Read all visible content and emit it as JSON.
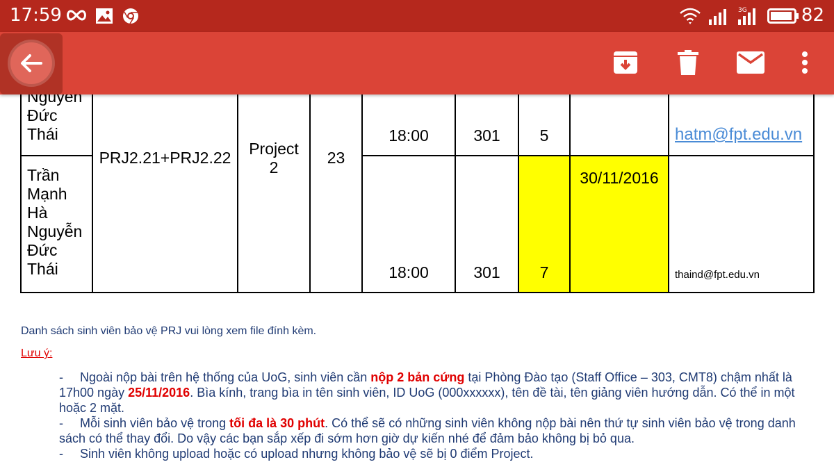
{
  "status_bar": {
    "time": "17:59",
    "battery": "82",
    "network": "3G"
  },
  "toolbar": {
    "icons": [
      "back-arrow-icon",
      "archive-icon",
      "delete-icon",
      "mail-icon",
      "more-vert-icon"
    ],
    "accent_color": "#db4437"
  },
  "schedule": {
    "row1": {
      "names": [
        "Nguyễn",
        "Đức",
        "Thái"
      ],
      "time": "18:00",
      "room": "301",
      "order": "5",
      "email": "hatm@fpt.edu.vn"
    },
    "row2": {
      "names": [
        "Trần",
        "Mạnh",
        "Hà",
        "Nguyễn",
        "Đức",
        "Thái"
      ],
      "time": "18:00",
      "room": "301",
      "order": "7",
      "date": "30/11/2016",
      "email": "thaind@fpt.edu.vn"
    },
    "shared": {
      "class_code": "PRJ2.21+PRJ2.22",
      "subject_line1": "Project",
      "subject_line2": "2",
      "count": "23"
    },
    "highlight_color": "#ffff00"
  },
  "content": {
    "intro": "Danh sách sinh viên bảo vệ PRJ vui lòng xem file đính kèm.",
    "note_title": "Lưu ý:",
    "bullet1": {
      "dash": "-",
      "part1": "Ngoài nộp bài trên hệ thống của UoG, sinh viên cần ",
      "bold1": "nộp 2 bản cứng",
      "part2": " tại Phòng Đào tạo (Staff Office – 303, CMT8) chậm nhất là 17h00 ngày ",
      "bold2": "25/11/2016",
      "part3": ". Bìa kính, trang bìa in tên sinh viên, ID UoG (000xxxxxx), tên đề tài, tên giảng viên hướng dẫn. Có thể in một hoặc 2 mặt."
    },
    "bullet2": {
      "dash": "-",
      "part1": "Mỗi sinh viên bảo vệ trong ",
      "bold1": "tối đa là 30 phút",
      "part2": ". Có thể sẽ có những sinh viên không nộp bài nên thứ tự sinh viên bảo vệ trong danh sách có thể thay đổi. Do vậy các bạn sắp xếp đi sớm hơn giờ dự kiến nhé để đảm bảo không bị bỏ qua."
    },
    "bullet3": {
      "dash": "-",
      "part1": "Sinh viên không upload hoặc có upload nhưng không bảo vệ sẽ bị 0 điểm Project."
    }
  }
}
